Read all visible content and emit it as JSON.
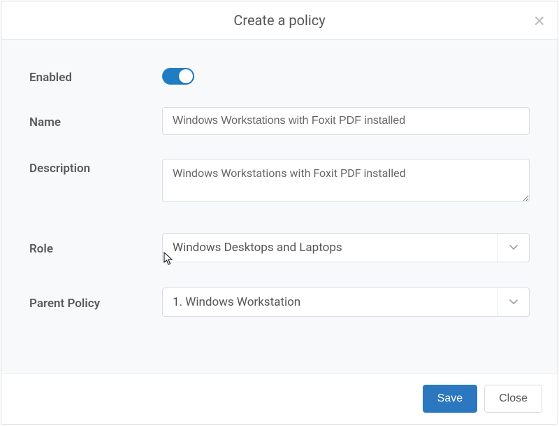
{
  "header": {
    "title": "Create a policy"
  },
  "form": {
    "enabled_label": "Enabled",
    "enabled_value": true,
    "name_label": "Name",
    "name_value": "Windows Workstations with Foxit PDF installed",
    "description_label": "Description",
    "description_value": "Windows Workstations with Foxit PDF installed",
    "role_label": "Role",
    "role_value": "Windows Desktops and Laptops",
    "parent_label": "Parent Policy",
    "parent_value": "1. Windows Workstation"
  },
  "footer": {
    "save_label": "Save",
    "close_label": "Close"
  }
}
